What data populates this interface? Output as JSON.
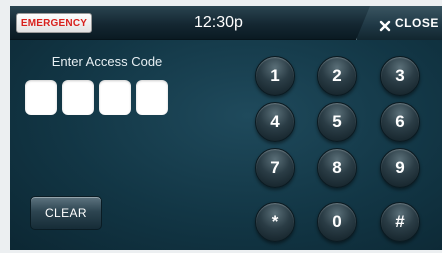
{
  "topbar": {
    "emergency_label": "EMERGENCY",
    "time": "12:30p",
    "close_label": "CLOSE",
    "close_icon": "close-icon"
  },
  "access": {
    "prompt": "Enter Access Code",
    "slots": [
      "",
      "",
      "",
      ""
    ]
  },
  "keypad": {
    "keys": [
      "1",
      "2",
      "3",
      "4",
      "5",
      "6",
      "7",
      "8",
      "9",
      "*",
      "0",
      "#"
    ]
  },
  "clear_label": "CLEAR",
  "colors": {
    "background": "#123645",
    "emergency_text": "#d8201c",
    "text": "#ffffff"
  }
}
